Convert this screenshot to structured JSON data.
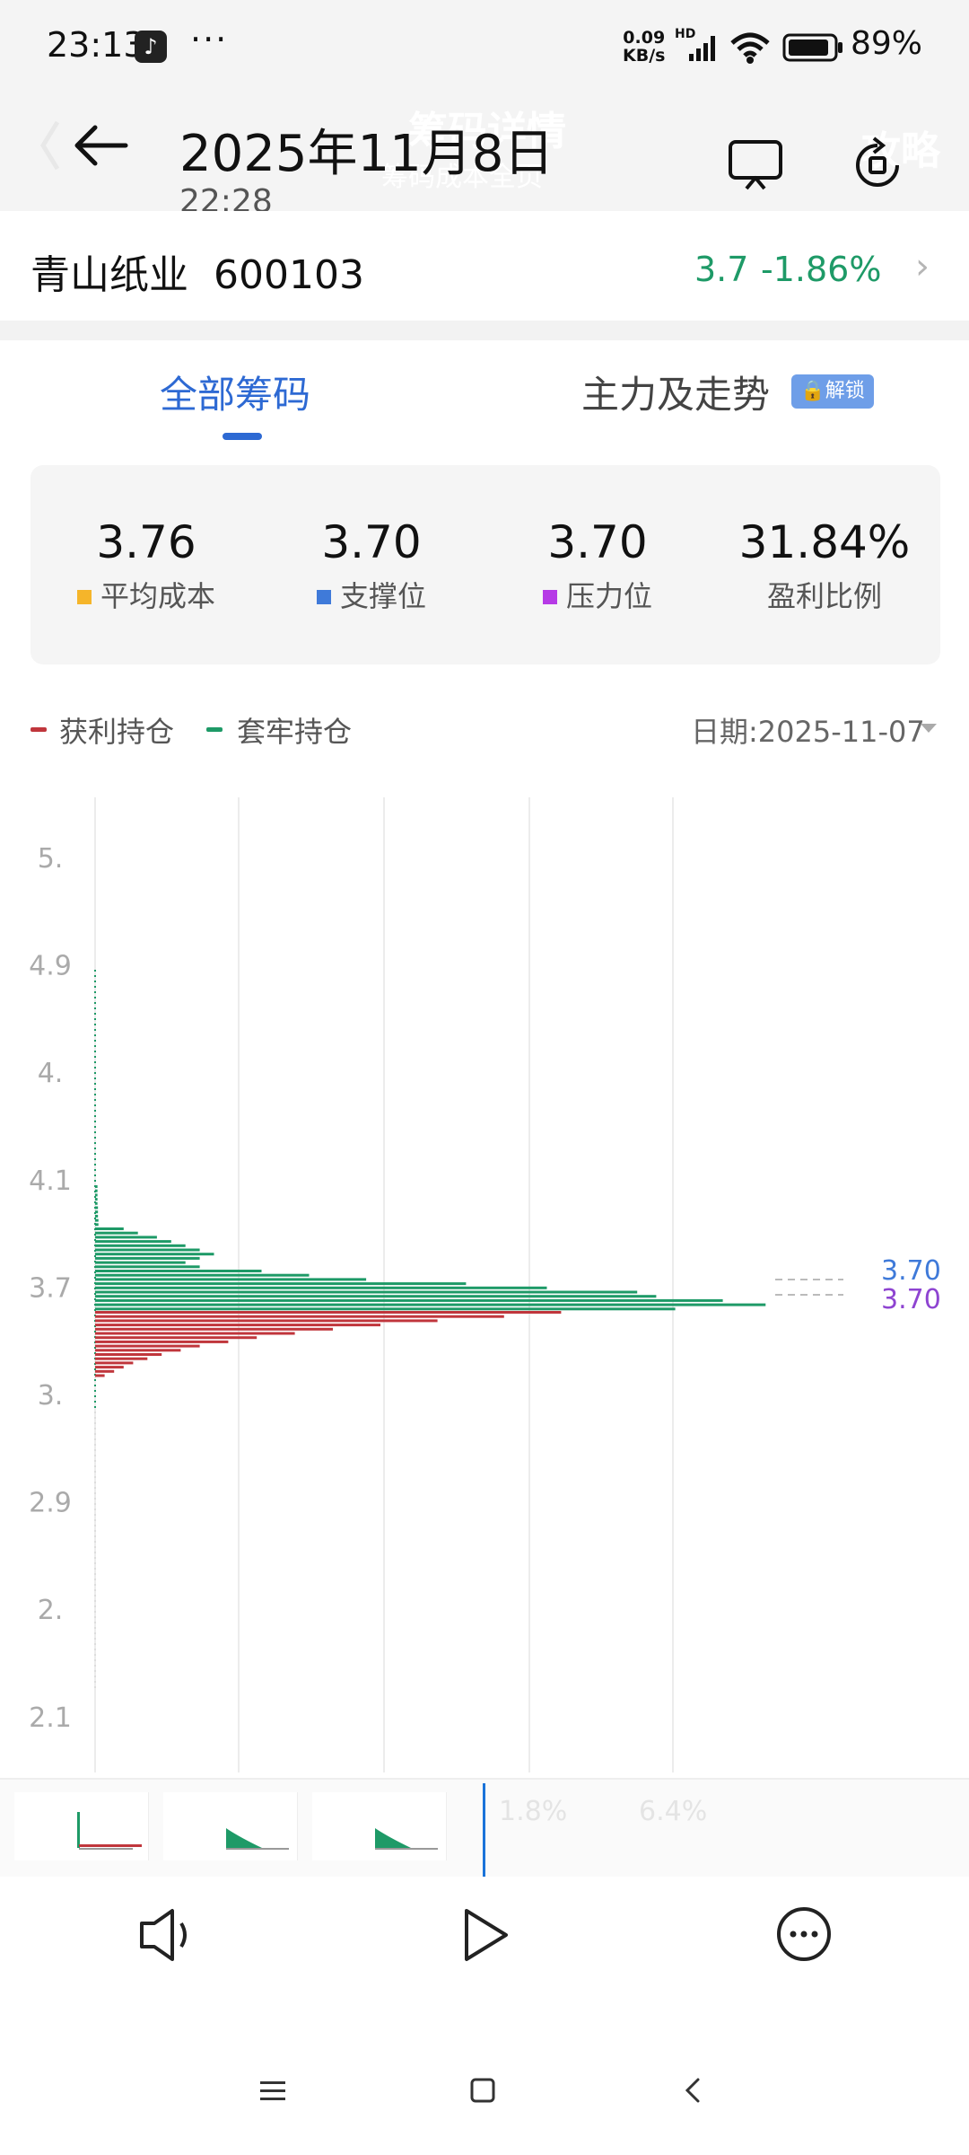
{
  "status_bar": {
    "time": "23:13",
    "more": "···",
    "net_speed_value": "0.09",
    "net_speed_unit": "KB/s",
    "hd": "HD",
    "battery": "89%",
    "icons": [
      "tiktok-icon",
      "signal-icon",
      "wifi-icon",
      "battery-icon"
    ]
  },
  "header": {
    "date": "2025年11月8日",
    "time": "22:28",
    "ghost_title": "筹码详情",
    "ghost_subtitle": "筹码成本全页",
    "ghost_right": "攻略",
    "icons": [
      "back-arrow-icon",
      "cast-icon",
      "rotate-icon"
    ]
  },
  "stock": {
    "name": "青山纸业",
    "code": "600103",
    "price": "3.7",
    "change": "-1.86%"
  },
  "tabs": {
    "all_chips": "全部筹码",
    "main_force": "主力及走势",
    "unlock_badge": "解锁"
  },
  "stats": [
    {
      "value": "3.76",
      "label": "平均成本",
      "color": "#f5b52a"
    },
    {
      "value": "3.70",
      "label": "支撑位",
      "color": "#3f7ad9"
    },
    {
      "value": "3.70",
      "label": "压力位",
      "color": "#b63ae6"
    },
    {
      "value": "31.84%",
      "label": "盈利比例",
      "color": ""
    }
  ],
  "legend": {
    "profit": "获利持仓",
    "trapped": "套牢持仓",
    "profit_color": "#c0363c",
    "trapped_color": "#1e9a67",
    "date_label": "日期:2025-11-07"
  },
  "chart_data": {
    "type": "bar",
    "orientation": "horizontal",
    "y_tick_labels": [
      "5.",
      "4.9",
      "4.",
      "4.1",
      "3.7",
      "3.",
      "2.9",
      "2.",
      "2.1"
    ],
    "support_level": "3.70",
    "pressure_level": "3.70",
    "support_color": "#3f7ad9",
    "pressure_color": "#8e44d1",
    "series": [
      {
        "name": "套牢持仓",
        "color": "#1e9a67",
        "values": [
          0.5,
          0.5,
          0.5,
          0.5,
          0.5,
          0.6,
          0.6,
          0.6,
          0.7,
          0.7,
          6,
          9,
          13,
          16,
          19,
          22,
          25,
          22,
          19,
          22,
          35,
          45,
          57,
          78,
          95,
          114,
          118,
          132,
          141,
          122
        ]
      },
      {
        "name": "获利持仓",
        "color": "#c0363c",
        "values": [
          98,
          86,
          72,
          60,
          50,
          42,
          34,
          28,
          22,
          18,
          14,
          11,
          8,
          6,
          4,
          2
        ]
      }
    ]
  },
  "timeline": {
    "ghost_pct_1": "1.8%",
    "ghost_pct_2": "6.4%"
  },
  "controls": {
    "icons": [
      "volume-icon",
      "play-icon",
      "more-circle-icon"
    ]
  },
  "nav": {
    "icons": [
      "menu-icon",
      "home-icon",
      "back-icon"
    ]
  }
}
